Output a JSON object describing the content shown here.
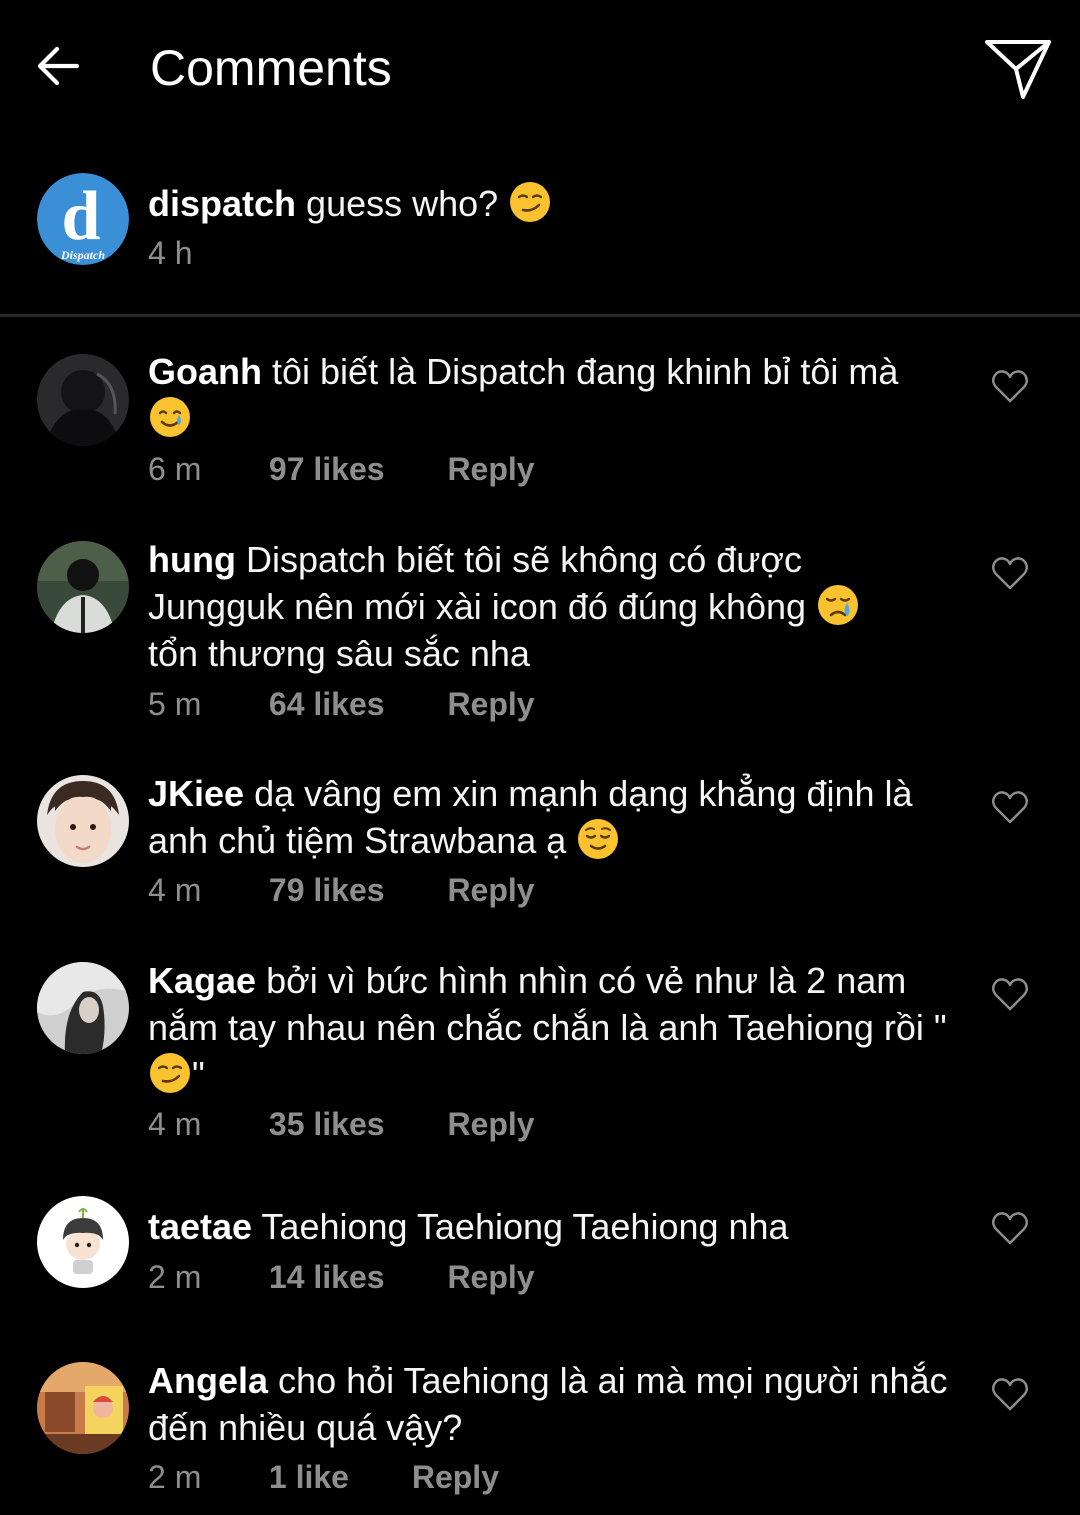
{
  "header": {
    "title": "Comments",
    "back_icon": "arrow-left-icon",
    "send_icon": "paper-plane-icon"
  },
  "caption": {
    "username": "dispatch",
    "text": "guess who?",
    "emoji": "smirk",
    "time": "4 h",
    "avatar_text": "d",
    "avatar_subtext": "Dispatch"
  },
  "comments": [
    {
      "username": "Goanh",
      "text": "tôi biết là Dispatch đang khinh bỉ tôi mà",
      "emoji": "smile-tear",
      "time": "6 m",
      "likes": "97 likes",
      "reply": "Reply"
    },
    {
      "username": "hung",
      "text": "Dispatch biết tôi sẽ không có được Jungguk nên mới xài icon đó đúng không",
      "emoji": "cry",
      "text_after": "tổn thương sâu sắc nha",
      "time": "5 m",
      "likes": "64 likes",
      "reply": "Reply"
    },
    {
      "username": "JKiee",
      "text": "dạ vâng em xin mạnh dạng khẳng định là anh chủ tiệm Strawbana ạ",
      "emoji": "relieved",
      "time": "4 m",
      "likes": "79 likes",
      "reply": "Reply"
    },
    {
      "username": "Kagae",
      "text": "bởi vì bức hình nhìn có vẻ như là 2 nam nắm tay nhau nên chắc chắn là anh Taehiong rồi \"",
      "emoji": "smirk",
      "text_after": "\"",
      "time": "4 m",
      "likes": "35 likes",
      "reply": "Reply"
    },
    {
      "username": "taetae",
      "text": "Taehiong Taehiong Taehiong nha",
      "time": "2 m",
      "likes": "14 likes",
      "reply": "Reply"
    },
    {
      "username": "Angela",
      "text": "cho hỏi Taehiong là ai mà mọi người nhắc đến nhiều quá vậy?",
      "time": "2 m",
      "likes": "1 like",
      "reply": "Reply"
    }
  ],
  "colors": {
    "background": "#000000",
    "meta_text": "#8e8e8e",
    "divider": "#262626",
    "dispatch_blue": "#3b8fd6"
  }
}
